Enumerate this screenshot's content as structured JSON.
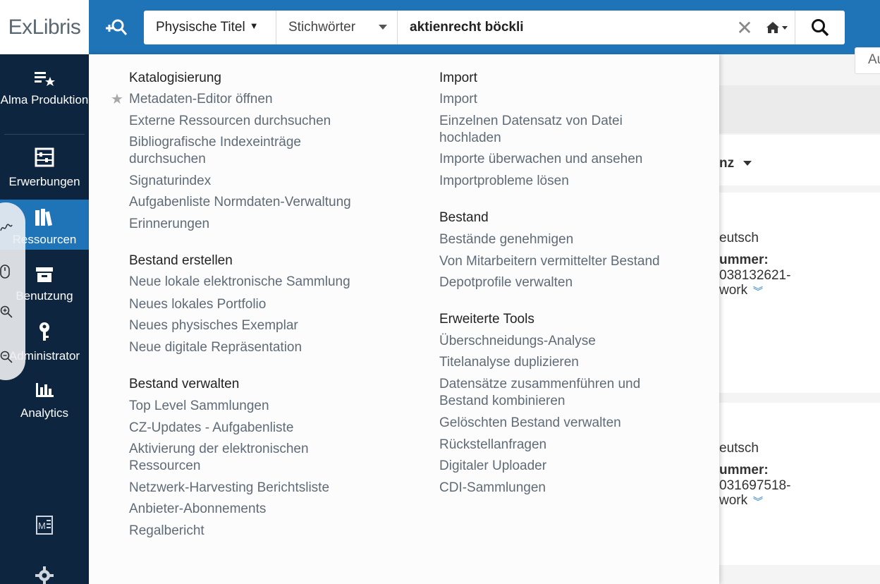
{
  "header": {
    "logo": "ExLibris",
    "search_type": "Physische Titel",
    "search_field": "Stichwörter",
    "search_value": "aktienrecht böckli"
  },
  "nav": {
    "items": [
      {
        "label": "Alma Produktion",
        "icon": "alma-star-list-icon"
      },
      {
        "label": "Erwerbungen",
        "icon": "abacus-icon"
      },
      {
        "label": "Ressourcen",
        "icon": "books-icon"
      },
      {
        "label": "Benutzung",
        "icon": "archive-box-icon"
      },
      {
        "label": "Administrator",
        "icon": "key-icon"
      },
      {
        "label": "Analytics",
        "icon": "bar-chart-icon"
      }
    ],
    "active": "Ressourcen",
    "bottom_icons": [
      "metadata-editor-icon",
      "gear-icon"
    ]
  },
  "menu": {
    "left": {
      "katalogisierung": {
        "title": "Katalogisierung",
        "items": [
          "Metadaten-Editor öffnen",
          "Externe Ressourcen durchsuchen",
          "Bibliografische Indexeinträge",
          "durchsuchen",
          "Signaturindex",
          "Aufgabenliste Normdaten-Verwaltung",
          "Erinnerungen"
        ]
      },
      "bestand_erstellen": {
        "title": "Bestand erstellen",
        "items": [
          "Neue lokale elektronische Sammlung",
          "Neues lokales Portfolio",
          "Neues physisches Exemplar",
          "Neue digitale Repräsentation"
        ]
      },
      "bestand_verwalten": {
        "title": "Bestand verwalten",
        "items": [
          "Top Level Sammlungen",
          "CZ-Updates - Aufgabenliste",
          "Aktivierung der elektronischen",
          "Ressourcen",
          "Netzwerk-Harvesting Berichtsliste",
          "Anbieter-Abonnements",
          "Regalbericht"
        ]
      }
    },
    "right": {
      "import": {
        "title": "Import",
        "items": [
          "Import",
          "Einzelnen Datensatz von Datei",
          "hochladen",
          "Importe überwachen und ansehen",
          "Importprobleme lösen"
        ]
      },
      "bestand": {
        "title": "Bestand",
        "items": [
          "Bestände genehmigen",
          "Von Mitarbeitern vermittelter Bestand",
          "Depotprofile verwalten"
        ]
      },
      "erweiterte_tools": {
        "title": "Erweiterte Tools",
        "items": [
          "Überschneidungs-Analyse",
          "Titelanalyse duplizieren",
          "Datensätze zusammenführen und",
          "Bestand kombinieren",
          "Gelöschten Bestand verwalten",
          "Rückstellanfragen",
          "Digitaler Uploader",
          "CDI-Sammlungen"
        ]
      }
    }
  },
  "background": {
    "top_right": "Au",
    "sort_label": "nz",
    "result1": {
      "lang": "eutsch",
      "label": "ummer:",
      "number": "038132621-",
      "suffix": "work"
    },
    "result2": {
      "lang": "eutsch",
      "label": "ummer:",
      "number": "031697518-",
      "suffix": "work"
    }
  }
}
